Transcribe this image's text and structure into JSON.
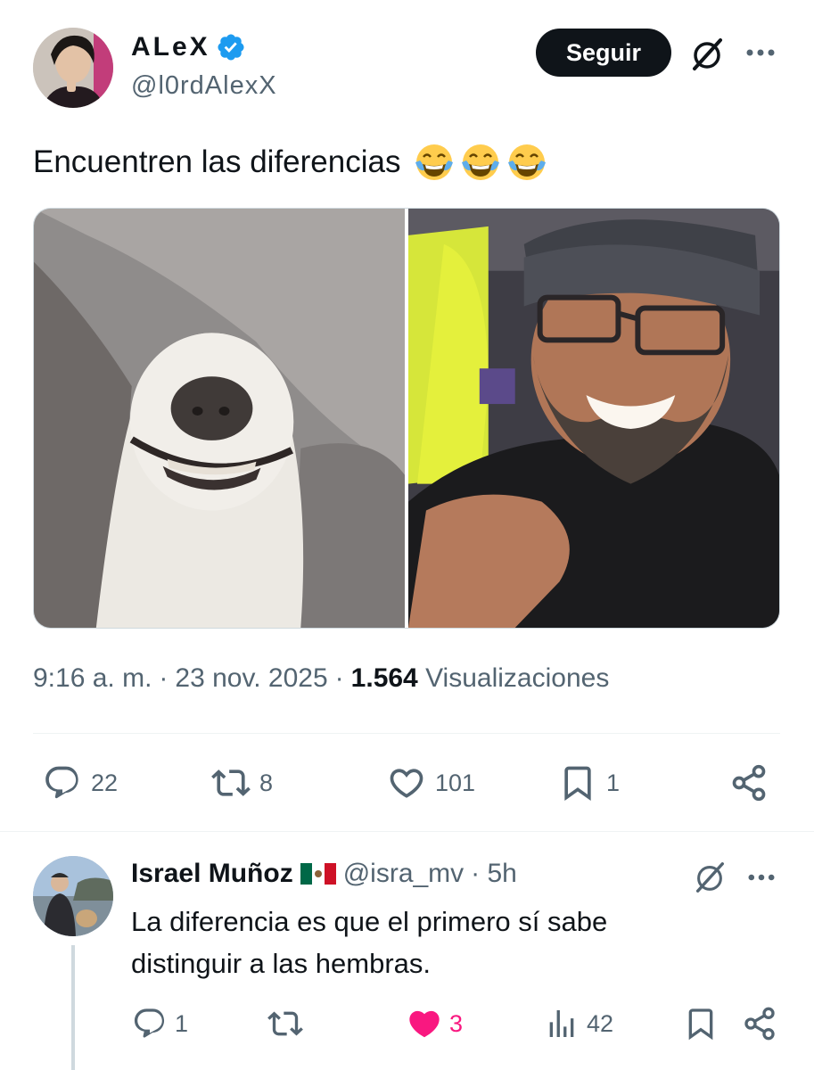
{
  "tweet": {
    "author": {
      "display_name": "ALeX",
      "handle": "@l0rdAlexX",
      "verified": true,
      "verified_color": "#1d9bf0"
    },
    "follow_label": "Seguir",
    "text": "Encuentren las diferencias",
    "emojis": [
      "face-with-tears-of-joy",
      "face-with-tears-of-joy",
      "face-with-tears-of-joy"
    ],
    "media": [
      {
        "description_icon": "smiling-dog-photo"
      },
      {
        "description_icon": "smiling-man-photo"
      }
    ],
    "time": "9:16 a. m.",
    "separator": "·",
    "date": "23 nov. 2025",
    "views_count": "1.564",
    "views_label": "Visualizaciones",
    "actions": {
      "replies": "22",
      "reposts": "8",
      "likes": "101",
      "bookmarks": "1"
    }
  },
  "reply": {
    "author": {
      "display_name": "Israel Muñoz",
      "flag": "mexico-flag",
      "handle": "@isra_mv",
      "time": "· 5h"
    },
    "text": "La diferencia es que el primero sí sabe distinguir a las hembras.",
    "actions": {
      "replies": "1",
      "likes": "3",
      "views": "42",
      "liked": true
    }
  },
  "colors": {
    "text_primary": "#0f1419",
    "text_secondary": "#536471",
    "like_active": "#f91880",
    "divider": "#eff3f4"
  }
}
